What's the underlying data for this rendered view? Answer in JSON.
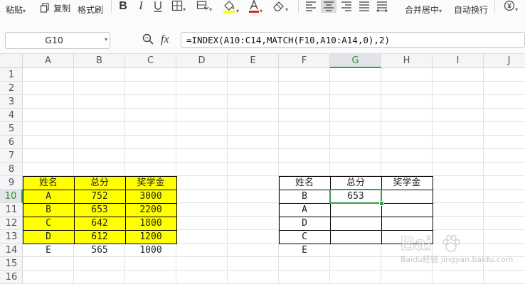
{
  "toolbar": {
    "paste_label": "粘贴",
    "copy_label": "复制",
    "format_painter_label": "格式刷",
    "merge_center_label": "合并居中",
    "wrap_text_label": "自动换行"
  },
  "formula_bar": {
    "name_box": "G10",
    "fx_label": "fx",
    "formula": "=INDEX(A10:C14,MATCH(F10,A10:A14,0),2)"
  },
  "columns": [
    "A",
    "B",
    "C",
    "D",
    "E",
    "F",
    "G",
    "H",
    "I",
    "J"
  ],
  "rows": [
    "1",
    "2",
    "3",
    "4",
    "5",
    "6",
    "7",
    "8",
    "9",
    "10",
    "11",
    "12",
    "13",
    "14",
    "15",
    "16"
  ],
  "table1": {
    "headers": [
      "姓名",
      "总分",
      "奖学金"
    ],
    "rows": [
      [
        "A",
        "752",
        "3000"
      ],
      [
        "B",
        "653",
        "2200"
      ],
      [
        "C",
        "642",
        "1800"
      ],
      [
        "D",
        "612",
        "1200"
      ],
      [
        "E",
        "565",
        "1000"
      ]
    ]
  },
  "table2": {
    "headers": [
      "姓名",
      "总分",
      "奖学金"
    ],
    "rows": [
      [
        "B",
        "653",
        ""
      ],
      [
        "A",
        "",
        ""
      ],
      [
        "D",
        "",
        ""
      ],
      [
        "C",
        "",
        ""
      ],
      [
        "E",
        "",
        ""
      ]
    ]
  },
  "active_cell": "G10",
  "watermark": "Baidu经验 jingyan.baidu.com",
  "colors": {
    "yellow_fill": "#ffff00",
    "active_green": "#3a9a4c",
    "header_bg": "#f4f5f7",
    "grid": "#e2e2e2"
  }
}
